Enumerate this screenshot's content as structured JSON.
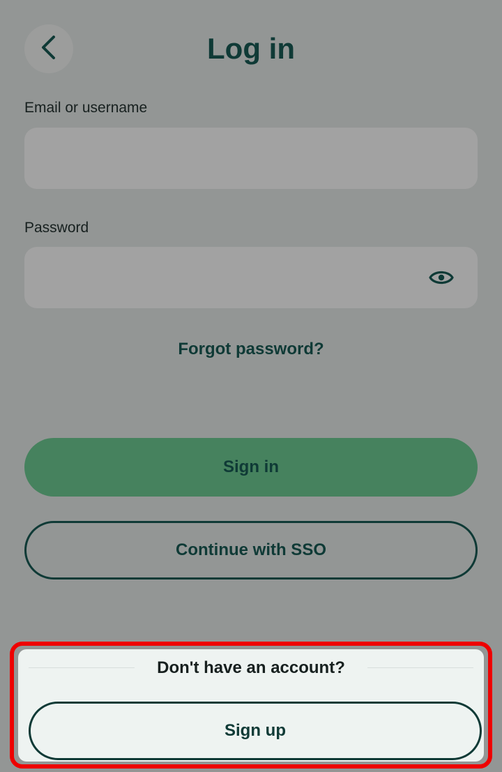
{
  "header": {
    "title": "Log in",
    "back_icon": "chevron-left-icon"
  },
  "form": {
    "email": {
      "label": "Email or username",
      "value": "",
      "placeholder": ""
    },
    "password": {
      "label": "Password",
      "value": "",
      "placeholder": "",
      "toggle_icon": "eye-icon"
    },
    "forgot_link": "Forgot password?"
  },
  "actions": {
    "sign_in_label": "Sign in",
    "sso_label": "Continue with SSO"
  },
  "signup": {
    "prompt": "Don't have an account?",
    "button_label": "Sign up"
  },
  "colors": {
    "backdrop": "#939695",
    "primary_text": "#0f3a36",
    "sign_in_button": "#46825e",
    "signup_panel": "#eef3f1",
    "highlight_border": "#ee0000"
  }
}
